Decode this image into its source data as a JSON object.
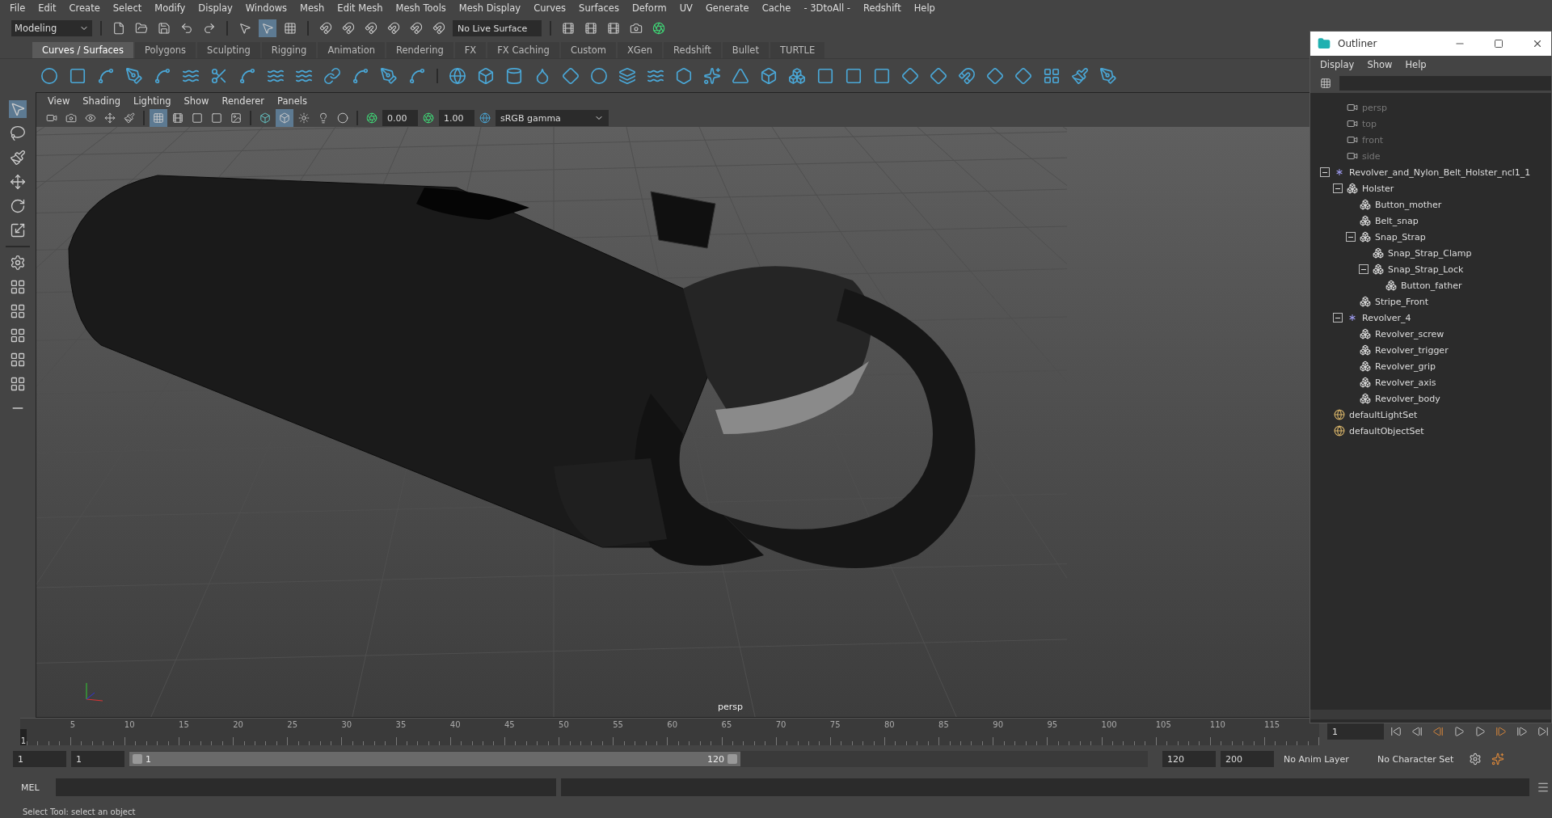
{
  "menu_bar": [
    "File",
    "Edit",
    "Create",
    "Select",
    "Modify",
    "Display",
    "Windows",
    "Mesh",
    "Edit Mesh",
    "Mesh Tools",
    "Mesh Display",
    "Curves",
    "Surfaces",
    "Deform",
    "UV",
    "Generate",
    "Cache",
    "- 3DtoAll -",
    "Redshift",
    "Help"
  ],
  "status_line": {
    "workspace": "Modeling",
    "live_surface": "No Live Surface"
  },
  "shelf_tabs": [
    {
      "label": "Curves / Surfaces",
      "selected": true
    },
    {
      "label": "Polygons",
      "selected": false
    },
    {
      "label": "Sculpting",
      "selected": false
    },
    {
      "label": "Rigging",
      "selected": false
    },
    {
      "label": "Animation",
      "selected": false
    },
    {
      "label": "Rendering",
      "selected": false
    },
    {
      "label": "FX",
      "selected": false
    },
    {
      "label": "FX Caching",
      "selected": false
    },
    {
      "label": "Custom",
      "selected": false
    },
    {
      "label": "XGen",
      "selected": false
    },
    {
      "label": "Redshift",
      "selected": false
    },
    {
      "label": "Bullet",
      "selected": false
    },
    {
      "label": "TURTLE",
      "selected": false
    }
  ],
  "viewport": {
    "menus": [
      "View",
      "Shading",
      "Lighting",
      "Show",
      "Renderer",
      "Panels"
    ],
    "exposure": "0.00",
    "gamma": "1.00",
    "color_space": "sRGB gamma",
    "camera_label": "persp"
  },
  "outliner": {
    "title": "Outliner",
    "menus": [
      "Display",
      "Show",
      "Help"
    ],
    "items": [
      {
        "label": "persp",
        "kind": "camera"
      },
      {
        "label": "top",
        "kind": "camera"
      },
      {
        "label": "front",
        "kind": "camera"
      },
      {
        "label": "side",
        "kind": "camera"
      },
      {
        "label": "Revolver_and_Nylon_Belt_Holster_ncl1_1",
        "kind": "group",
        "expanded": true,
        "children": [
          {
            "label": "Holster",
            "kind": "mesh",
            "expanded": true,
            "children": [
              {
                "label": "Button_mother",
                "kind": "mesh"
              },
              {
                "label": "Belt_snap",
                "kind": "mesh"
              },
              {
                "label": "Snap_Strap",
                "kind": "mesh",
                "expanded": true,
                "children": [
                  {
                    "label": "Snap_Strap_Clamp",
                    "kind": "mesh"
                  },
                  {
                    "label": "Snap_Strap_Lock",
                    "kind": "mesh",
                    "expanded": true,
                    "children": [
                      {
                        "label": "Button_father",
                        "kind": "mesh"
                      }
                    ]
                  }
                ]
              },
              {
                "label": "Stripe_Front",
                "kind": "mesh"
              }
            ]
          },
          {
            "label": "Revolver_4",
            "kind": "group",
            "expanded": true,
            "children": [
              {
                "label": "Revolver_screw",
                "kind": "mesh"
              },
              {
                "label": "Revolver_trigger",
                "kind": "mesh"
              },
              {
                "label": "Revolver_grip",
                "kind": "mesh"
              },
              {
                "label": "Revolver_axis",
                "kind": "mesh"
              },
              {
                "label": "Revolver_body",
                "kind": "mesh"
              }
            ]
          }
        ]
      },
      {
        "label": "defaultLightSet",
        "kind": "set"
      },
      {
        "label": "defaultObjectSet",
        "kind": "set"
      }
    ]
  },
  "time_slider": {
    "marker": "1",
    "ticks": [
      "5",
      "10",
      "15",
      "20",
      "25",
      "30",
      "35",
      "40",
      "45",
      "50",
      "55",
      "60",
      "65",
      "70",
      "75",
      "80",
      "85",
      "90",
      "95",
      "100",
      "105",
      "110",
      "115"
    ],
    "current_frame": "1",
    "level": 0
  },
  "range_slider": {
    "start": "1",
    "playback_start": "1",
    "range_start": "1",
    "range_end": "120",
    "playback_end": "120",
    "end": "200",
    "anim_layer": "No Anim Layer",
    "character_set": "No Character Set",
    "level": 0.6
  },
  "command_line": {
    "language": "MEL"
  },
  "help_line": "Select Tool: select an object"
}
